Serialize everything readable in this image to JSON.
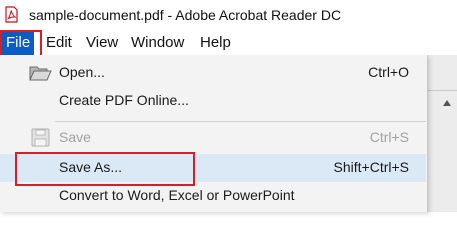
{
  "window": {
    "title": "sample-document.pdf - Adobe Acrobat Reader DC",
    "icon": "acrobat-pdf-icon"
  },
  "menubar": {
    "items": [
      {
        "label": "File",
        "active": true
      },
      {
        "label": "Edit"
      },
      {
        "label": "View"
      },
      {
        "label": "Window"
      },
      {
        "label": "Help"
      }
    ]
  },
  "file_menu": {
    "items": [
      {
        "label": "Open...",
        "shortcut": "Ctrl+O",
        "icon": "folder-open-icon",
        "enabled": true
      },
      {
        "label": "Create PDF Online...",
        "shortcut": "",
        "enabled": true
      },
      {
        "label": "Save",
        "shortcut": "Ctrl+S",
        "icon": "save-disk-icon",
        "enabled": false
      },
      {
        "label": "Save As...",
        "shortcut": "Shift+Ctrl+S",
        "enabled": true,
        "hovered": true
      },
      {
        "label": "Convert to Word, Excel or PowerPoint",
        "shortcut": "",
        "enabled": true
      }
    ]
  },
  "colors": {
    "menu_active": "#0b5cc6",
    "highlight_box": "#d32027",
    "hover_bg": "#dbe9f7",
    "disabled_text": "#a2a2a2"
  }
}
